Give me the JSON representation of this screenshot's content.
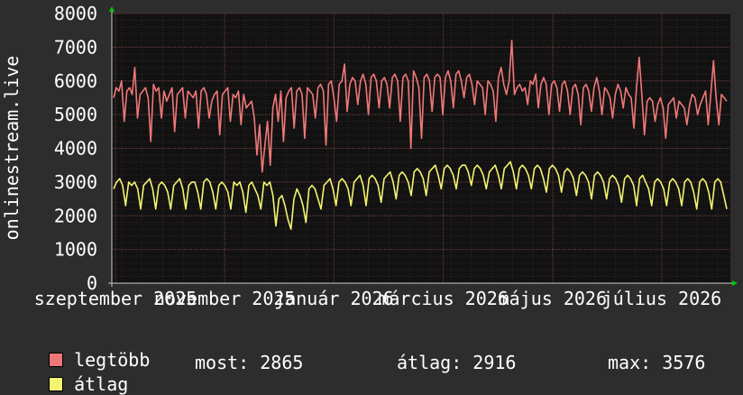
{
  "chart_data": {
    "type": "line",
    "ylabel": "onlinestream.live",
    "ylim": [
      0,
      8000
    ],
    "yticks": [
      0,
      1000,
      2000,
      3000,
      4000,
      5000,
      6000,
      7000,
      8000
    ],
    "xlabels": [
      "szeptember 2025",
      "november 2025",
      "január 2026",
      "március 2026",
      "május 2026",
      "július 2026"
    ],
    "grid": true,
    "series": [
      {
        "name": "legtöbb",
        "color": "#f07878",
        "values": [
          5500,
          5800,
          5700,
          6000,
          4800,
          5700,
          5800,
          5600,
          6400,
          4900,
          5600,
          5700,
          5800,
          5500,
          4200,
          5900,
          5700,
          5800,
          4900,
          5700,
          5400,
          5600,
          5800,
          4500,
          5600,
          5700,
          5800,
          4900,
          5700,
          5600,
          5500,
          5700,
          4600,
          5700,
          5800,
          5600,
          4900,
          5400,
          5600,
          5700,
          4400,
          5600,
          5700,
          5800,
          4800,
          5600,
          5500,
          5700,
          4700,
          5600,
          5200,
          5300,
          5400,
          4900,
          3800,
          4700,
          3300,
          4100,
          4800,
          3500,
          5200,
          5600,
          4800,
          5700,
          4200,
          5500,
          5700,
          5800,
          4600,
          5700,
          5800,
          5600,
          4300,
          5800,
          5700,
          5600,
          4900,
          5800,
          5900,
          5700,
          4100,
          5900,
          6000,
          5500,
          4800,
          5900,
          6000,
          6500,
          5100,
          5900,
          6100,
          6000,
          5300,
          6000,
          6200,
          5900,
          5000,
          6100,
          6200,
          6000,
          5200,
          6000,
          6100,
          5900,
          5200,
          6100,
          6200,
          6000,
          4800,
          6100,
          6200,
          6000,
          4000,
          6300,
          6100,
          5800,
          4300,
          6100,
          6200,
          6000,
          5100,
          6100,
          6200,
          6100,
          5000,
          6100,
          6300,
          6000,
          5200,
          6200,
          6300,
          6000,
          5500,
          6100,
          6200,
          5900,
          5300,
          6000,
          5900,
          5800,
          5000,
          6000,
          5900,
          5700,
          4800,
          6100,
          6400,
          5900,
          5600,
          6000,
          7200,
          5600,
          5800,
          5900,
          5700,
          5800,
          5300,
          6000,
          5900,
          6200,
          5200,
          5900,
          6100,
          5900,
          5000,
          5900,
          6000,
          5800,
          5100,
          5900,
          6000,
          5700,
          5000,
          5800,
          5900,
          5600,
          4700,
          5800,
          5900,
          5700,
          5100,
          5800,
          6100,
          5700,
          5000,
          5800,
          5700,
          5500,
          4900,
          5600,
          5900,
          5700,
          5200,
          5800,
          5600,
          5500,
          4600,
          5800,
          6700,
          5600,
          4400,
          5400,
          5500,
          5400,
          4800,
          5300,
          5500,
          5200,
          4300,
          5300,
          5400,
          5500,
          4900,
          5400,
          5300,
          5200,
          4700,
          5300,
          5600,
          5500,
          5000,
          5300,
          5500,
          5700,
          4700,
          5600,
          6600,
          5500,
          4700,
          5600,
          5500,
          5400
        ]
      },
      {
        "name": "átlag",
        "color": "#f4f470",
        "values": [
          2800,
          3000,
          3100,
          2900,
          2300,
          3000,
          2900,
          3000,
          2800,
          2200,
          2900,
          3000,
          3100,
          2800,
          2200,
          2900,
          3000,
          2900,
          2700,
          2200,
          2900,
          3000,
          3100,
          2800,
          2200,
          2900,
          3000,
          3000,
          2700,
          2200,
          3000,
          3100,
          3000,
          2700,
          2200,
          2900,
          3000,
          2900,
          2700,
          2200,
          3000,
          2900,
          3000,
          2700,
          2100,
          2900,
          3000,
          2800,
          2600,
          2200,
          3000,
          2900,
          3000,
          2600,
          1700,
          2500,
          2600,
          2300,
          1900,
          1600,
          2500,
          2800,
          2600,
          2300,
          1800,
          2800,
          2900,
          2800,
          2500,
          2200,
          2900,
          3000,
          3100,
          2800,
          2300,
          3000,
          3100,
          3000,
          2800,
          2300,
          3000,
          3100,
          3200,
          2900,
          2300,
          3100,
          3200,
          3100,
          2900,
          2400,
          3100,
          3200,
          3300,
          3000,
          2500,
          3200,
          3300,
          3200,
          3000,
          2600,
          3300,
          3400,
          3300,
          3100,
          2600,
          3300,
          3400,
          3500,
          3200,
          2800,
          3400,
          3500,
          3400,
          3200,
          2800,
          3400,
          3500,
          3500,
          3300,
          2900,
          3400,
          3500,
          3400,
          3200,
          2800,
          3300,
          3400,
          3500,
          3200,
          2800,
          3400,
          3500,
          3600,
          3300,
          2800,
          3400,
          3500,
          3400,
          3200,
          2800,
          3400,
          3500,
          3400,
          3100,
          2700,
          3400,
          3500,
          3400,
          3200,
          2700,
          3300,
          3400,
          3300,
          3100,
          2600,
          3200,
          3300,
          3200,
          3000,
          2500,
          3200,
          3300,
          3200,
          3000,
          2500,
          3100,
          3200,
          3100,
          2900,
          2400,
          3100,
          3200,
          3100,
          2900,
          2300,
          3100,
          3200,
          3000,
          2800,
          2300,
          3000,
          3100,
          3000,
          2800,
          2300,
          3000,
          3100,
          3000,
          2800,
          2300,
          3000,
          3100,
          3000,
          2700,
          2200,
          3000,
          3100,
          3000,
          2700,
          2200,
          3000,
          3100,
          3000,
          2600,
          2200
        ]
      }
    ]
  },
  "legend": {
    "max_label": "legtöbb",
    "avg_label": "átlag",
    "most": "most: 2865",
    "atlag": "átlag: 2916",
    "max": "max: 3576"
  },
  "colors": {
    "background": "#2d2d2d",
    "plot": "#121212",
    "grid": "#6a3a3a",
    "axis_arrow": "#00cc00"
  }
}
